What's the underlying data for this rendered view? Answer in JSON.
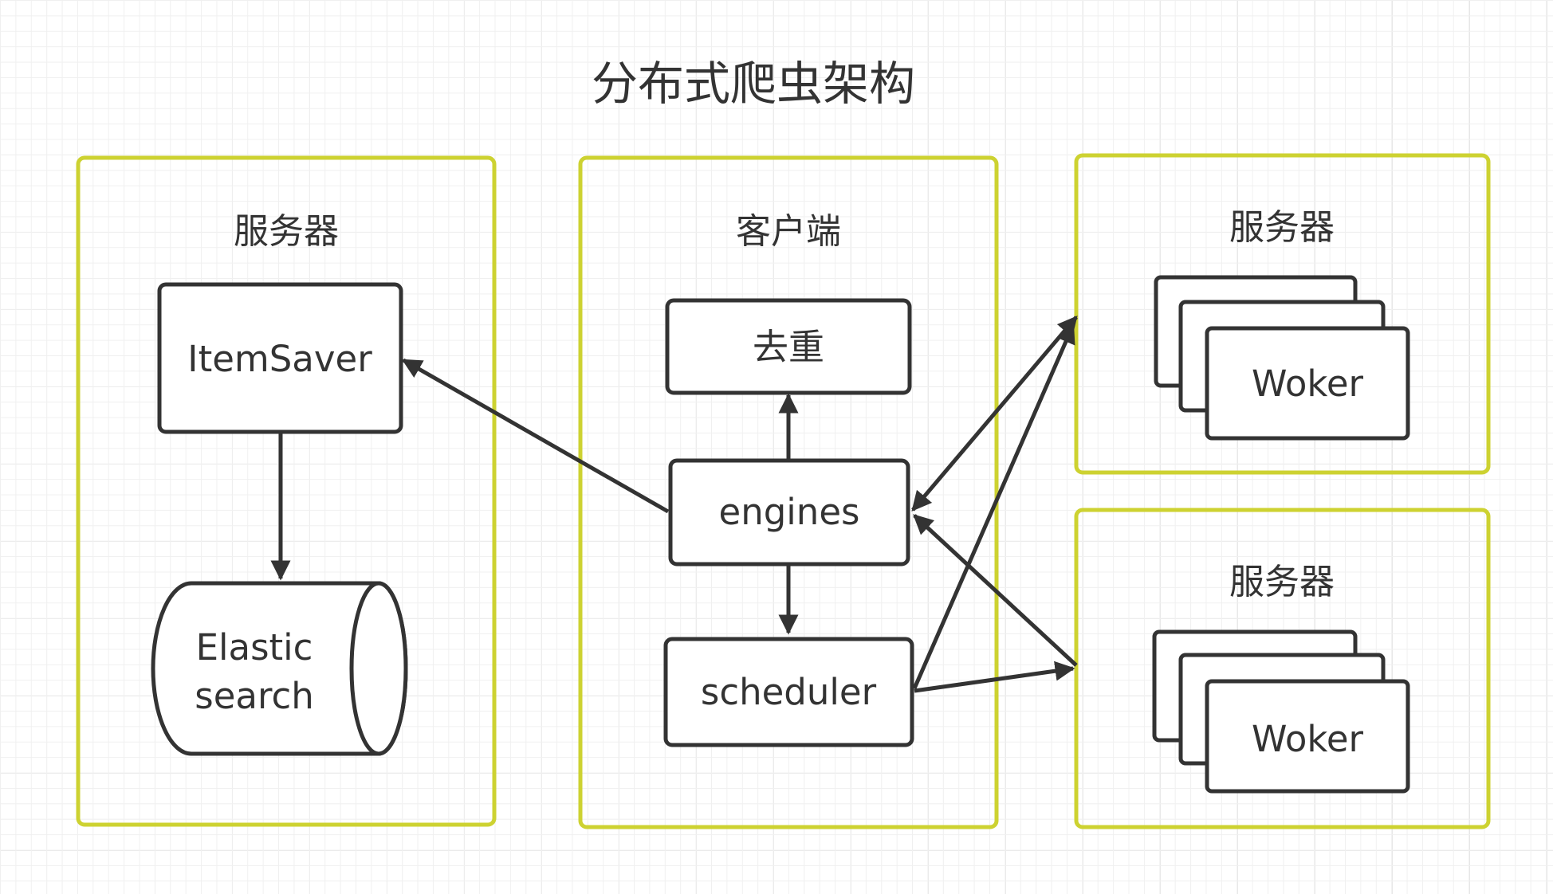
{
  "title": "分布式爬虫架构",
  "colors": {
    "container_border": "#cdd231",
    "node_border": "#333333",
    "text": "#333333",
    "grid": "#e6e6e6"
  },
  "containers": {
    "left_server": {
      "label": "服务器"
    },
    "client": {
      "label": "客户端"
    },
    "right_server_top": {
      "label": "服务器"
    },
    "right_server_bottom": {
      "label": "服务器"
    }
  },
  "nodes": {
    "itemsaver": {
      "label": "ItemSaver"
    },
    "elastic": {
      "line1": "Elastic",
      "line2": "search"
    },
    "dedup": {
      "label": "去重"
    },
    "engines": {
      "label": "engines"
    },
    "scheduler": {
      "label": "scheduler"
    },
    "worker_top": {
      "label": "Woker"
    },
    "worker_bottom": {
      "label": "Woker"
    }
  },
  "edges": [
    {
      "from": "engines",
      "to": "itemsaver",
      "arrow": "end"
    },
    {
      "from": "itemsaver",
      "to": "elastic",
      "arrow": "end"
    },
    {
      "from": "engines",
      "to": "dedup",
      "arrow": "end"
    },
    {
      "from": "engines",
      "to": "scheduler",
      "arrow": "end"
    },
    {
      "from": "engines",
      "to": "right_server_top",
      "arrow": "both"
    },
    {
      "from": "scheduler",
      "to": "right_server_top",
      "arrow": "end"
    },
    {
      "from": "scheduler",
      "to": "right_server_bottom",
      "arrow": "end"
    },
    {
      "from": "right_server_bottom",
      "to": "engines",
      "arrow": "end"
    }
  ]
}
